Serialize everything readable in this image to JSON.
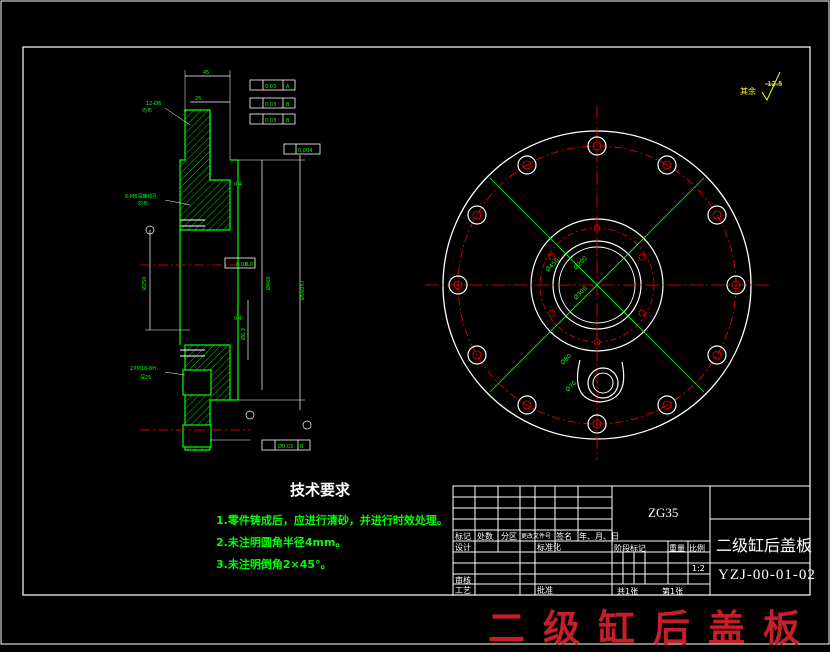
{
  "technical_requirements": {
    "title": "技术要求",
    "items": [
      "1.零件铸成后，应进行清砂，并进行时效处理。",
      "2.未注明圆角半径4mm。",
      "3.未注明倒角2×45°。"
    ]
  },
  "title_block": {
    "material": "ZG35",
    "part_name": "二级缸后盖板",
    "drawing_number": "YZJ-00-01-02",
    "labels": {
      "biaoji": "标记",
      "chushu": "处数",
      "fenqu": "分区",
      "gengai": "更改文件号",
      "qianming": "签名",
      "date": "年、月、日",
      "sheji": "设计",
      "biaozhunhua": "标准化",
      "jieduan": "阶段标记",
      "zhongliang": "重量",
      "bili": "比例",
      "scale": "1:2",
      "shenhe": "审核",
      "gongyi": "工艺",
      "pizhun": "批准",
      "gong": "共1张",
      "di": "第1张"
    }
  },
  "surface_roughness": {
    "label": "其余",
    "value": "12.5"
  },
  "watermark": "二级缸后盖板",
  "colors": {
    "background": "#000000",
    "frame": "#ffffff",
    "outline": "#00ff00",
    "centerline": "#ff0000",
    "dimension": "#ffffff",
    "hatch": "#00ff00",
    "watermark": "#c81e2a"
  }
}
